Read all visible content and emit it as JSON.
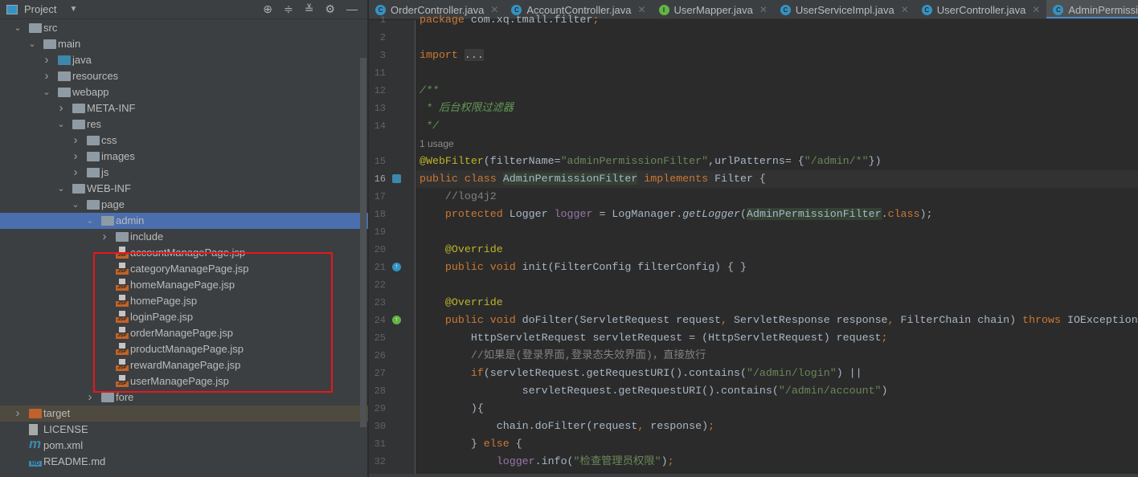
{
  "project_panel": {
    "title": "Project",
    "icons": [
      "locate-icon",
      "expand-all-icon",
      "collapse-all-icon",
      "gear-icon",
      "minimize-icon"
    ]
  },
  "tree": [
    {
      "label": "src",
      "level": 0,
      "expanded": true,
      "icon": "folder"
    },
    {
      "label": "main",
      "level": 1,
      "expanded": true,
      "icon": "folder"
    },
    {
      "label": "java",
      "level": 2,
      "expanded": false,
      "icon": "folder-source"
    },
    {
      "label": "resources",
      "level": 2,
      "expanded": false,
      "icon": "folder-resources"
    },
    {
      "label": "webapp",
      "level": 2,
      "expanded": true,
      "icon": "folder-web"
    },
    {
      "label": "META-INF",
      "level": 3,
      "expanded": false,
      "icon": "folder"
    },
    {
      "label": "res",
      "level": 3,
      "expanded": true,
      "icon": "folder"
    },
    {
      "label": "css",
      "level": 4,
      "expanded": false,
      "icon": "folder"
    },
    {
      "label": "images",
      "level": 4,
      "expanded": false,
      "icon": "folder"
    },
    {
      "label": "js",
      "level": 4,
      "expanded": false,
      "icon": "folder"
    },
    {
      "label": "WEB-INF",
      "level": 3,
      "expanded": true,
      "icon": "folder"
    },
    {
      "label": "page",
      "level": 4,
      "expanded": true,
      "icon": "folder"
    },
    {
      "label": "admin",
      "level": 5,
      "expanded": true,
      "icon": "folder",
      "selected": true
    },
    {
      "label": "include",
      "level": 6,
      "expanded": false,
      "icon": "folder"
    },
    {
      "label": "accountManagePage.jsp",
      "level": 6,
      "icon": "jsp"
    },
    {
      "label": "categoryManagePage.jsp",
      "level": 6,
      "icon": "jsp"
    },
    {
      "label": "homeManagePage.jsp",
      "level": 6,
      "icon": "jsp"
    },
    {
      "label": "homePage.jsp",
      "level": 6,
      "icon": "jsp"
    },
    {
      "label": "loginPage.jsp",
      "level": 6,
      "icon": "jsp"
    },
    {
      "label": "orderManagePage.jsp",
      "level": 6,
      "icon": "jsp"
    },
    {
      "label": "productManagePage.jsp",
      "level": 6,
      "icon": "jsp"
    },
    {
      "label": "rewardManagePage.jsp",
      "level": 6,
      "icon": "jsp"
    },
    {
      "label": "userManagePage.jsp",
      "level": 6,
      "icon": "jsp"
    },
    {
      "label": "fore",
      "level": 5,
      "expanded": false,
      "icon": "folder"
    },
    {
      "label": "target",
      "level": 0,
      "expanded": false,
      "icon": "folder-excluded",
      "excluded": true
    },
    {
      "label": "LICENSE",
      "level": 0,
      "icon": "text-file"
    },
    {
      "label": "pom.xml",
      "level": 0,
      "icon": "maven"
    },
    {
      "label": "README.md",
      "level": 0,
      "icon": "markdown"
    }
  ],
  "tabs": [
    {
      "label": "OrderController.java",
      "kind": "C"
    },
    {
      "label": "AccountController.java",
      "kind": "C"
    },
    {
      "label": "UserMapper.java",
      "kind": "I"
    },
    {
      "label": "UserServiceImpl.java",
      "kind": "C"
    },
    {
      "label": "UserController.java",
      "kind": "C"
    },
    {
      "label": "AdminPermission",
      "kind": "C",
      "active": true
    }
  ],
  "colors": {
    "keyword": "#cc7832",
    "string": "#6a8759",
    "comment": "#808080",
    "doc_comment": "#629755",
    "annotation": "#bbb529",
    "field": "#9876aa",
    "selection": "#4b6eaf",
    "highlight_box": "#e8161c"
  },
  "code": [
    {
      "n": "1",
      "t": [
        [
          "package ",
          "kw"
        ],
        [
          "com.xq.tmall.filter",
          ""
        ],
        [
          ";",
          "kw"
        ]
      ]
    },
    {
      "n": "2",
      "t": []
    },
    {
      "n": "3",
      "t": [
        [
          "import ",
          "kw"
        ],
        [
          "...",
          "fold"
        ]
      ]
    },
    {
      "n": "11",
      "t": []
    },
    {
      "n": "12",
      "t": [
        [
          "/**",
          "dc"
        ]
      ]
    },
    {
      "n": "13",
      "t": [
        [
          " * 后台权限过滤器",
          "dc"
        ]
      ]
    },
    {
      "n": "14",
      "t": [
        [
          " */",
          "dc"
        ]
      ]
    },
    {
      "n": "",
      "hint": "1 usage"
    },
    {
      "n": "15",
      "t": [
        [
          "@WebFilter",
          "an"
        ],
        [
          "(filterName=",
          ""
        ],
        [
          "\"adminPermissionFilter\"",
          "st"
        ],
        [
          ",urlPatterns= {",
          ""
        ],
        [
          "\"/admin/*\"",
          "st"
        ],
        [
          "})",
          ""
        ]
      ]
    },
    {
      "n": "16",
      "cur": true,
      "gutter": "class-icon",
      "t": [
        [
          "public class ",
          "kw"
        ],
        [
          "AdminPermissionFilter",
          "hl"
        ],
        [
          " implements ",
          "kw"
        ],
        [
          "Filter {",
          ""
        ]
      ]
    },
    {
      "n": "17",
      "t": [
        [
          "    //log4j2",
          "cm"
        ]
      ]
    },
    {
      "n": "18",
      "t": [
        [
          "    protected ",
          "kw"
        ],
        [
          "Logger ",
          ""
        ],
        [
          "logger",
          "fd"
        ],
        [
          " = LogManager.",
          ""
        ],
        [
          "getLogger",
          "it"
        ],
        [
          "(",
          ""
        ],
        [
          "AdminPermissionFilter",
          "hl"
        ],
        [
          ".",
          ""
        ],
        [
          "class",
          "kw"
        ],
        [
          ");",
          ""
        ]
      ]
    },
    {
      "n": "19",
      "t": []
    },
    {
      "n": "20",
      "t": [
        [
          "    @Override",
          "an"
        ]
      ]
    },
    {
      "n": "21",
      "gutter": "implements-icon",
      "t": [
        [
          "    public void ",
          "kw"
        ],
        [
          "init(FilterConfig filterConfig) { }",
          ""
        ]
      ]
    },
    {
      "n": "22",
      "t": []
    },
    {
      "n": "23",
      "t": [
        [
          "    @Override",
          "an"
        ]
      ]
    },
    {
      "n": "24",
      "gutter": "override-icon",
      "t": [
        [
          "    public void ",
          "kw"
        ],
        [
          "doFilter(ServletRequest request",
          ""
        ],
        [
          ", ",
          "kw"
        ],
        [
          "ServletResponse response",
          ""
        ],
        [
          ", ",
          "kw"
        ],
        [
          "FilterChain chain) ",
          ""
        ],
        [
          "throws ",
          "kw"
        ],
        [
          "IOException",
          ""
        ]
      ]
    },
    {
      "n": "25",
      "t": [
        [
          "        HttpServletRequest servletRequest = (HttpServletRequest) request",
          ""
        ],
        [
          ";",
          "kw"
        ]
      ]
    },
    {
      "n": "26",
      "t": [
        [
          "        //如果是(登录界面,登录态失效界面)，直接放行",
          "cm"
        ]
      ]
    },
    {
      "n": "27",
      "t": [
        [
          "        if",
          "kw"
        ],
        [
          "(servletRequest.getRequestURI().contains(",
          ""
        ],
        [
          "\"/admin/login\"",
          "st"
        ],
        [
          ") ||",
          ""
        ]
      ]
    },
    {
      "n": "28",
      "t": [
        [
          "                servletRequest.getRequestURI().contains(",
          ""
        ],
        [
          "\"/admin/account\"",
          "st"
        ],
        [
          ")",
          ""
        ]
      ]
    },
    {
      "n": "29",
      "t": [
        [
          "        ){",
          ""
        ]
      ]
    },
    {
      "n": "30",
      "t": [
        [
          "            chain.doFilter(request",
          ""
        ],
        [
          ", ",
          "kw"
        ],
        [
          "response)",
          ""
        ],
        [
          ";",
          "kw"
        ]
      ]
    },
    {
      "n": "31",
      "t": [
        [
          "        } ",
          ""
        ],
        [
          "else ",
          "kw"
        ],
        [
          "{",
          ""
        ]
      ]
    },
    {
      "n": "32",
      "t": [
        [
          "            ",
          ""
        ],
        [
          "logger",
          "fd"
        ],
        [
          ".info(",
          ""
        ],
        [
          "\"检查管理员权限\"",
          "st"
        ],
        [
          ")",
          ""
        ],
        [
          ";",
          "kw"
        ]
      ]
    }
  ]
}
